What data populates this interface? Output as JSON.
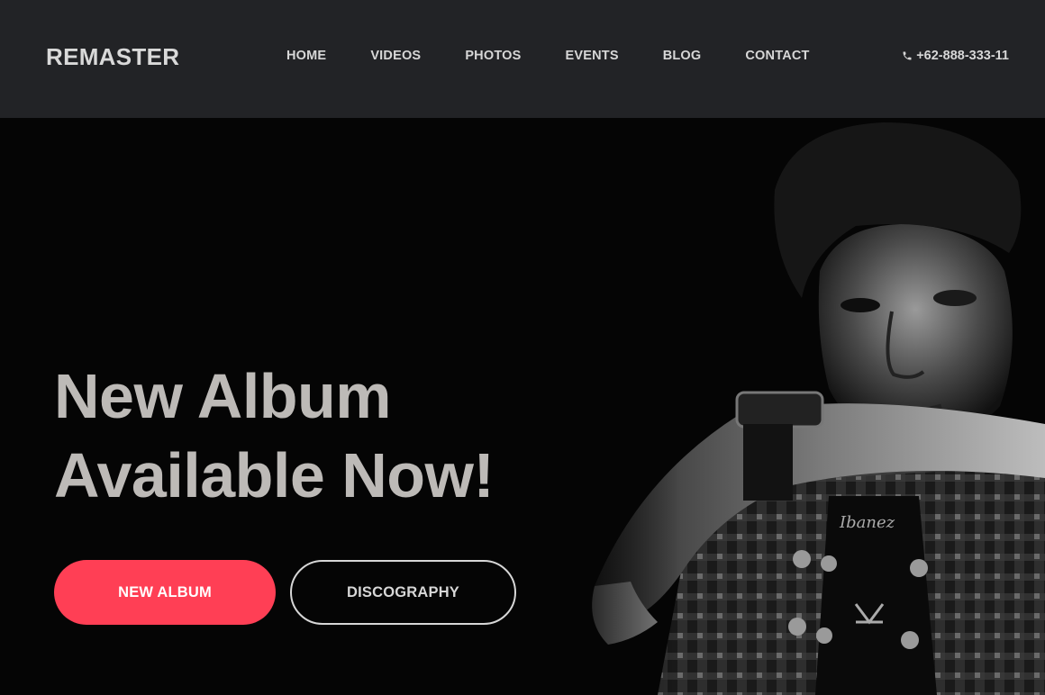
{
  "brand": {
    "logo": "REMASTER"
  },
  "nav": {
    "items": [
      {
        "label": "HOME"
      },
      {
        "label": "VIDEOS"
      },
      {
        "label": "PHOTOS"
      },
      {
        "label": "EVENTS"
      },
      {
        "label": "BLOG"
      },
      {
        "label": "CONTACT"
      }
    ],
    "phone": {
      "icon": "phone-icon",
      "number": "+62-888-333-11"
    }
  },
  "hero": {
    "headline_line1": "New Album",
    "headline_line2": "Available Now!",
    "primary_button": "NEW ALBUM",
    "secondary_button": "DISCOGRAPHY",
    "image": "black-and-white portrait of young musician resting arm on guitar headstock"
  },
  "colors": {
    "navbar_bg": "#222326",
    "hero_bg": "#050505",
    "accent": "#ff3f55",
    "headline": "#bdbab7",
    "nav_text": "#d7d7d7"
  }
}
